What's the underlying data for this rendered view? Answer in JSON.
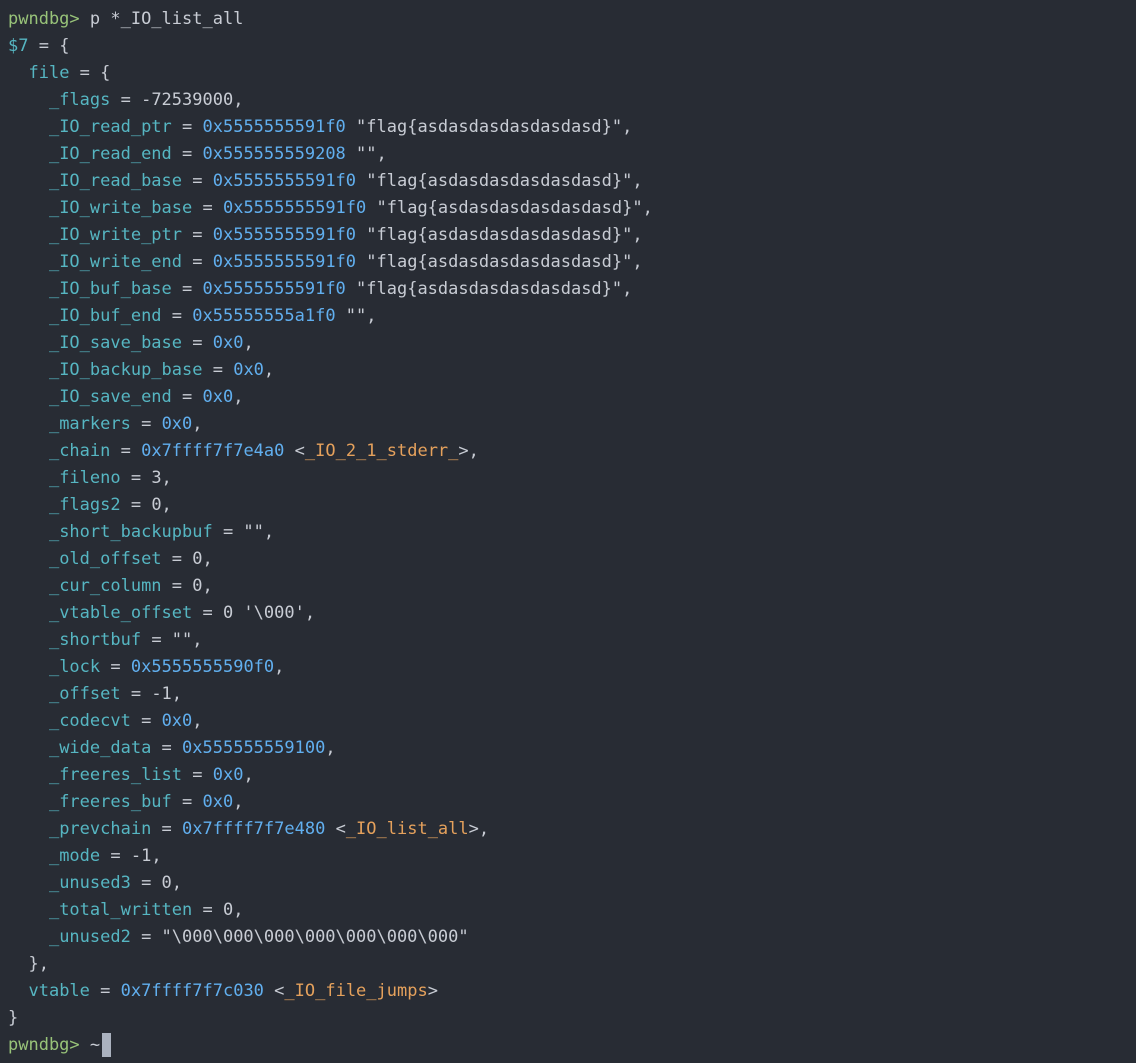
{
  "terminal": {
    "prompt": "pwndbg>",
    "command": "p *_IO_list_all",
    "history_number": "$7",
    "colors": {
      "background": "#282c34",
      "prompt": "#98c379",
      "field": "#56b6c2",
      "address": "#61afef",
      "symbol": "#e5a15c",
      "text": "#c8ccd4"
    },
    "lines": [
      [
        {
          "t": "p",
          "v": "pwndbg>"
        },
        {
          "t": "x",
          "v": " p *_IO_list_all"
        }
      ],
      [
        {
          "t": "h",
          "v": "$7"
        },
        {
          "t": "x",
          "v": " = {"
        }
      ],
      [
        {
          "t": "x",
          "v": "  "
        },
        {
          "t": "f",
          "v": "file"
        },
        {
          "t": "x",
          "v": " = {"
        }
      ],
      [
        {
          "t": "x",
          "v": "    "
        },
        {
          "t": "f",
          "v": "_flags"
        },
        {
          "t": "x",
          "v": " = -72539000,"
        }
      ],
      [
        {
          "t": "x",
          "v": "    "
        },
        {
          "t": "f",
          "v": "_IO_read_ptr"
        },
        {
          "t": "x",
          "v": " = "
        },
        {
          "t": "a",
          "v": "0x5555555591f0"
        },
        {
          "t": "x",
          "v": " \"flag{asdasdasdasdasdasd}\","
        }
      ],
      [
        {
          "t": "x",
          "v": "    "
        },
        {
          "t": "f",
          "v": "_IO_read_end"
        },
        {
          "t": "x",
          "v": " = "
        },
        {
          "t": "a",
          "v": "0x555555559208"
        },
        {
          "t": "x",
          "v": " \"\","
        }
      ],
      [
        {
          "t": "x",
          "v": "    "
        },
        {
          "t": "f",
          "v": "_IO_read_base"
        },
        {
          "t": "x",
          "v": " = "
        },
        {
          "t": "a",
          "v": "0x5555555591f0"
        },
        {
          "t": "x",
          "v": " \"flag{asdasdasdasdasdasd}\","
        }
      ],
      [
        {
          "t": "x",
          "v": "    "
        },
        {
          "t": "f",
          "v": "_IO_write_base"
        },
        {
          "t": "x",
          "v": " = "
        },
        {
          "t": "a",
          "v": "0x5555555591f0"
        },
        {
          "t": "x",
          "v": " \"flag{asdasdasdasdasdasd}\","
        }
      ],
      [
        {
          "t": "x",
          "v": "    "
        },
        {
          "t": "f",
          "v": "_IO_write_ptr"
        },
        {
          "t": "x",
          "v": " = "
        },
        {
          "t": "a",
          "v": "0x5555555591f0"
        },
        {
          "t": "x",
          "v": " \"flag{asdasdasdasdasdasd}\","
        }
      ],
      [
        {
          "t": "x",
          "v": "    "
        },
        {
          "t": "f",
          "v": "_IO_write_end"
        },
        {
          "t": "x",
          "v": " = "
        },
        {
          "t": "a",
          "v": "0x5555555591f0"
        },
        {
          "t": "x",
          "v": " \"flag{asdasdasdasdasdasd}\","
        }
      ],
      [
        {
          "t": "x",
          "v": "    "
        },
        {
          "t": "f",
          "v": "_IO_buf_base"
        },
        {
          "t": "x",
          "v": " = "
        },
        {
          "t": "a",
          "v": "0x5555555591f0"
        },
        {
          "t": "x",
          "v": " \"flag{asdasdasdasdasdasd}\","
        }
      ],
      [
        {
          "t": "x",
          "v": "    "
        },
        {
          "t": "f",
          "v": "_IO_buf_end"
        },
        {
          "t": "x",
          "v": " = "
        },
        {
          "t": "a",
          "v": "0x55555555a1f0"
        },
        {
          "t": "x",
          "v": " \"\","
        }
      ],
      [
        {
          "t": "x",
          "v": "    "
        },
        {
          "t": "f",
          "v": "_IO_save_base"
        },
        {
          "t": "x",
          "v": " = "
        },
        {
          "t": "a",
          "v": "0x0"
        },
        {
          "t": "x",
          "v": ","
        }
      ],
      [
        {
          "t": "x",
          "v": "    "
        },
        {
          "t": "f",
          "v": "_IO_backup_base"
        },
        {
          "t": "x",
          "v": " = "
        },
        {
          "t": "a",
          "v": "0x0"
        },
        {
          "t": "x",
          "v": ","
        }
      ],
      [
        {
          "t": "x",
          "v": "    "
        },
        {
          "t": "f",
          "v": "_IO_save_end"
        },
        {
          "t": "x",
          "v": " = "
        },
        {
          "t": "a",
          "v": "0x0"
        },
        {
          "t": "x",
          "v": ","
        }
      ],
      [
        {
          "t": "x",
          "v": "    "
        },
        {
          "t": "f",
          "v": "_markers"
        },
        {
          "t": "x",
          "v": " = "
        },
        {
          "t": "a",
          "v": "0x0"
        },
        {
          "t": "x",
          "v": ","
        }
      ],
      [
        {
          "t": "x",
          "v": "    "
        },
        {
          "t": "f",
          "v": "_chain"
        },
        {
          "t": "x",
          "v": " = "
        },
        {
          "t": "a",
          "v": "0x7ffff7f7e4a0"
        },
        {
          "t": "x",
          "v": " <"
        },
        {
          "t": "s",
          "v": "_IO_2_1_stderr_"
        },
        {
          "t": "x",
          "v": ">,"
        }
      ],
      [
        {
          "t": "x",
          "v": "    "
        },
        {
          "t": "f",
          "v": "_fileno"
        },
        {
          "t": "x",
          "v": " = 3,"
        }
      ],
      [
        {
          "t": "x",
          "v": "    "
        },
        {
          "t": "f",
          "v": "_flags2"
        },
        {
          "t": "x",
          "v": " = 0,"
        }
      ],
      [
        {
          "t": "x",
          "v": "    "
        },
        {
          "t": "f",
          "v": "_short_backupbuf"
        },
        {
          "t": "x",
          "v": " = \"\","
        }
      ],
      [
        {
          "t": "x",
          "v": "    "
        },
        {
          "t": "f",
          "v": "_old_offset"
        },
        {
          "t": "x",
          "v": " = 0,"
        }
      ],
      [
        {
          "t": "x",
          "v": "    "
        },
        {
          "t": "f",
          "v": "_cur_column"
        },
        {
          "t": "x",
          "v": " = 0,"
        }
      ],
      [
        {
          "t": "x",
          "v": "    "
        },
        {
          "t": "f",
          "v": "_vtable_offset"
        },
        {
          "t": "x",
          "v": " = 0 '\\000',"
        }
      ],
      [
        {
          "t": "x",
          "v": "    "
        },
        {
          "t": "f",
          "v": "_shortbuf"
        },
        {
          "t": "x",
          "v": " = \"\","
        }
      ],
      [
        {
          "t": "x",
          "v": "    "
        },
        {
          "t": "f",
          "v": "_lock"
        },
        {
          "t": "x",
          "v": " = "
        },
        {
          "t": "a",
          "v": "0x5555555590f0"
        },
        {
          "t": "x",
          "v": ","
        }
      ],
      [
        {
          "t": "x",
          "v": "    "
        },
        {
          "t": "f",
          "v": "_offset"
        },
        {
          "t": "x",
          "v": " = -1,"
        }
      ],
      [
        {
          "t": "x",
          "v": "    "
        },
        {
          "t": "f",
          "v": "_codecvt"
        },
        {
          "t": "x",
          "v": " = "
        },
        {
          "t": "a",
          "v": "0x0"
        },
        {
          "t": "x",
          "v": ","
        }
      ],
      [
        {
          "t": "x",
          "v": "    "
        },
        {
          "t": "f",
          "v": "_wide_data"
        },
        {
          "t": "x",
          "v": " = "
        },
        {
          "t": "a",
          "v": "0x555555559100"
        },
        {
          "t": "x",
          "v": ","
        }
      ],
      [
        {
          "t": "x",
          "v": "    "
        },
        {
          "t": "f",
          "v": "_freeres_list"
        },
        {
          "t": "x",
          "v": " = "
        },
        {
          "t": "a",
          "v": "0x0"
        },
        {
          "t": "x",
          "v": ","
        }
      ],
      [
        {
          "t": "x",
          "v": "    "
        },
        {
          "t": "f",
          "v": "_freeres_buf"
        },
        {
          "t": "x",
          "v": " = "
        },
        {
          "t": "a",
          "v": "0x0"
        },
        {
          "t": "x",
          "v": ","
        }
      ],
      [
        {
          "t": "x",
          "v": "    "
        },
        {
          "t": "f",
          "v": "_prevchain"
        },
        {
          "t": "x",
          "v": " = "
        },
        {
          "t": "a",
          "v": "0x7ffff7f7e480"
        },
        {
          "t": "x",
          "v": " <"
        },
        {
          "t": "s",
          "v": "_IO_list_all"
        },
        {
          "t": "x",
          "v": ">,"
        }
      ],
      [
        {
          "t": "x",
          "v": "    "
        },
        {
          "t": "f",
          "v": "_mode"
        },
        {
          "t": "x",
          "v": " = -1,"
        }
      ],
      [
        {
          "t": "x",
          "v": "    "
        },
        {
          "t": "f",
          "v": "_unused3"
        },
        {
          "t": "x",
          "v": " = 0,"
        }
      ],
      [
        {
          "t": "x",
          "v": "    "
        },
        {
          "t": "f",
          "v": "_total_written"
        },
        {
          "t": "x",
          "v": " = 0,"
        }
      ],
      [
        {
          "t": "x",
          "v": "    "
        },
        {
          "t": "f",
          "v": "_unused2"
        },
        {
          "t": "x",
          "v": " = \"\\000\\000\\000\\000\\000\\000\\000\""
        }
      ],
      [
        {
          "t": "x",
          "v": "  },"
        }
      ],
      [
        {
          "t": "x",
          "v": "  "
        },
        {
          "t": "f",
          "v": "vtable"
        },
        {
          "t": "x",
          "v": " = "
        },
        {
          "t": "a",
          "v": "0x7ffff7f7c030"
        },
        {
          "t": "x",
          "v": " <"
        },
        {
          "t": "s",
          "v": "_IO_file_jumps"
        },
        {
          "t": "x",
          "v": ">"
        }
      ],
      [
        {
          "t": "x",
          "v": "}"
        }
      ]
    ],
    "input_line": {
      "prompt": "pwndbg>",
      "typed": " ~"
    }
  }
}
